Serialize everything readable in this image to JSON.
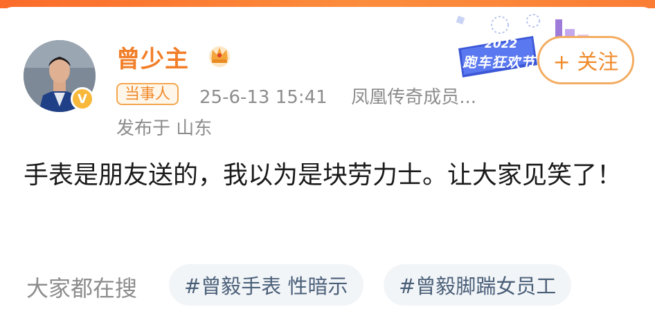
{
  "user": {
    "name": "曾少主",
    "tag": "当事人",
    "time": "25-6-13 15:41",
    "source": "凤凰传奇成员...",
    "location": "发布于 山东"
  },
  "banner": {
    "year": "2022",
    "text": "跑车狂欢节"
  },
  "follow": {
    "label": "+ 关注"
  },
  "post": {
    "text": "手表是朋友送的，我以为是块劳力士。让大家见笑了！"
  },
  "hot_search": {
    "label": "大家都在搜",
    "chips": [
      "#曾毅手表 性暗示",
      "#曾毅脚踹女员工"
    ]
  },
  "colors": {
    "name": "#f27e28",
    "tag": "#f08a2a",
    "meta": "#8c8c8c",
    "chip_bg": "#f2f5f8",
    "chip_text": "#4a5f78"
  }
}
